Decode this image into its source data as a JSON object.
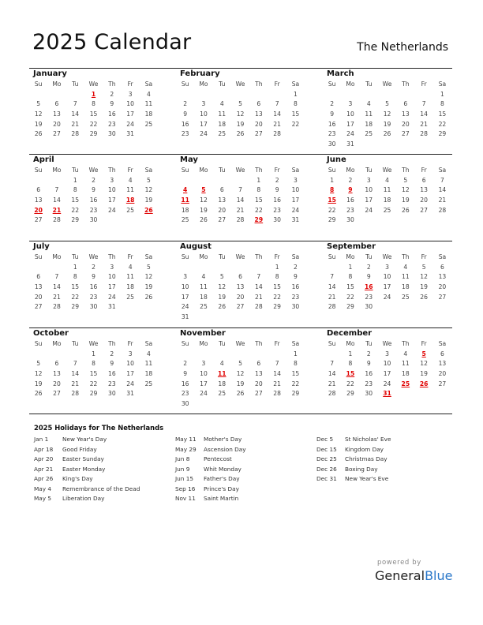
{
  "header": {
    "title": "2025 Calendar",
    "country": "The Netherlands"
  },
  "weekdays": [
    "Su",
    "Mo",
    "Tu",
    "We",
    "Th",
    "Fr",
    "Sa"
  ],
  "months": [
    {
      "name": "January",
      "start": 3,
      "days": 31,
      "holidays": [
        1
      ]
    },
    {
      "name": "February",
      "start": 6,
      "days": 28,
      "holidays": []
    },
    {
      "name": "March",
      "start": 6,
      "days": 31,
      "holidays": []
    },
    {
      "name": "April",
      "start": 2,
      "days": 30,
      "holidays": [
        18,
        20,
        21,
        26
      ]
    },
    {
      "name": "May",
      "start": 4,
      "days": 31,
      "holidays": [
        4,
        5,
        11,
        29
      ]
    },
    {
      "name": "June",
      "start": 0,
      "days": 30,
      "holidays": [
        8,
        9,
        15
      ]
    },
    {
      "name": "July",
      "start": 2,
      "days": 31,
      "holidays": []
    },
    {
      "name": "August",
      "start": 5,
      "days": 31,
      "holidays": []
    },
    {
      "name": "September",
      "start": 1,
      "days": 30,
      "holidays": [
        16
      ]
    },
    {
      "name": "October",
      "start": 3,
      "days": 31,
      "holidays": []
    },
    {
      "name": "November",
      "start": 6,
      "days": 30,
      "holidays": [
        11
      ]
    },
    {
      "name": "December",
      "start": 1,
      "days": 31,
      "holidays": [
        5,
        15,
        25,
        26,
        31
      ]
    }
  ],
  "holiday_list": {
    "title": "2025 Holidays for The Netherlands",
    "columns": [
      [
        {
          "date": "Jan 1",
          "name": "New Year's Day"
        },
        {
          "date": "Apr 18",
          "name": "Good Friday"
        },
        {
          "date": "Apr 20",
          "name": "Easter Sunday"
        },
        {
          "date": "Apr 21",
          "name": "Easter Monday"
        },
        {
          "date": "Apr 26",
          "name": "King's Day"
        },
        {
          "date": "May 4",
          "name": "Remembrance of the Dead"
        },
        {
          "date": "May 5",
          "name": "Liberation Day"
        }
      ],
      [
        {
          "date": "May 11",
          "name": "Mother's Day"
        },
        {
          "date": "May 29",
          "name": "Ascension Day"
        },
        {
          "date": "Jun 8",
          "name": "Pentecost"
        },
        {
          "date": "Jun 9",
          "name": "Whit Monday"
        },
        {
          "date": "Jun 15",
          "name": "Father's Day"
        },
        {
          "date": "Sep 16",
          "name": "Prince's Day"
        },
        {
          "date": "Nov 11",
          "name": "Saint Martin"
        }
      ],
      [
        {
          "date": "Dec 5",
          "name": "St Nicholas' Eve"
        },
        {
          "date": "Dec 15",
          "name": "Kingdom Day"
        },
        {
          "date": "Dec 25",
          "name": "Christmas Day"
        },
        {
          "date": "Dec 26",
          "name": "Boxing Day"
        },
        {
          "date": "Dec 31",
          "name": "New Year's Eve"
        }
      ]
    ]
  },
  "footer": {
    "powered_by": "powered by",
    "brand_general": "General",
    "brand_blue": "Blue"
  },
  "colors": {
    "holiday": "#e00000",
    "brand_blue": "#2a77c9"
  }
}
